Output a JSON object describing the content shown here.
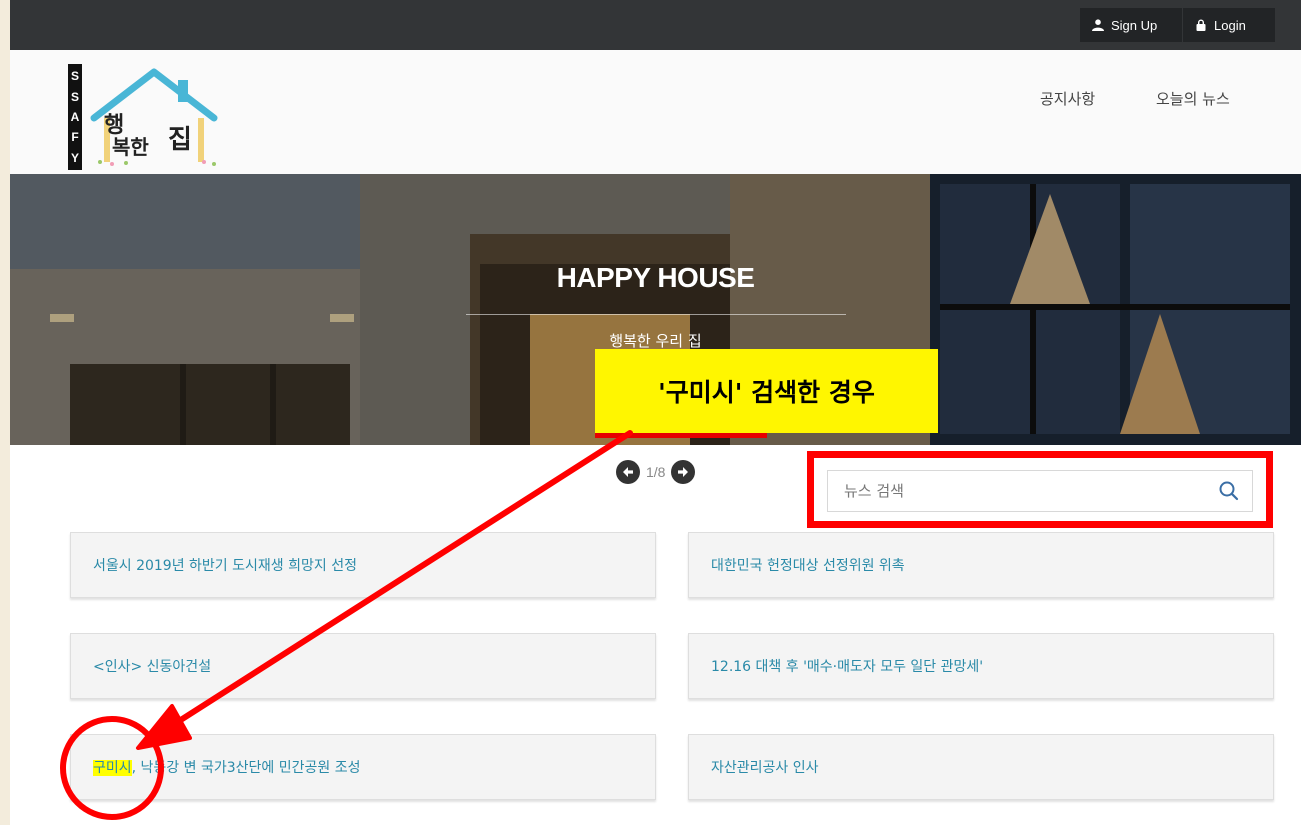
{
  "topbar": {
    "signup_label": "Sign Up",
    "login_label": "Login"
  },
  "logo": {
    "letters": [
      "S",
      "S",
      "A",
      "F",
      "Y"
    ],
    "text_top": "행",
    "text_mid": "복한",
    "text_house": "집"
  },
  "nav": {
    "notice_label": "공지사항",
    "news_label": "오늘의 뉴스"
  },
  "hero": {
    "title": "HAPPY HOUSE",
    "subtitle": "행복한 우리 집"
  },
  "annotation": {
    "label": "'구미시' 검색한 경우",
    "color": "#ff0000",
    "label_bg": "#fff600"
  },
  "pager": {
    "text": "1/8"
  },
  "search": {
    "placeholder": "뉴스 검색"
  },
  "news": {
    "items": [
      {
        "title": "서울시 2019년 하반기 도시재생 희망지 선정"
      },
      {
        "title": "대한민국 헌정대상 선정위원 위촉"
      },
      {
        "title": "<인사> 신동아건설"
      },
      {
        "title": "12.16 대책 후 '매수·매도자 모두 일단 관망세'"
      },
      {
        "highlight": "구미시",
        "rest": ", 낙동강 변 국가3산단에 민간공원 조성"
      },
      {
        "title": "자산관리공사 인사"
      }
    ]
  },
  "colors": {
    "link": "#2a8aa8",
    "topbar": "#333537",
    "highlight": "#ffff00"
  }
}
